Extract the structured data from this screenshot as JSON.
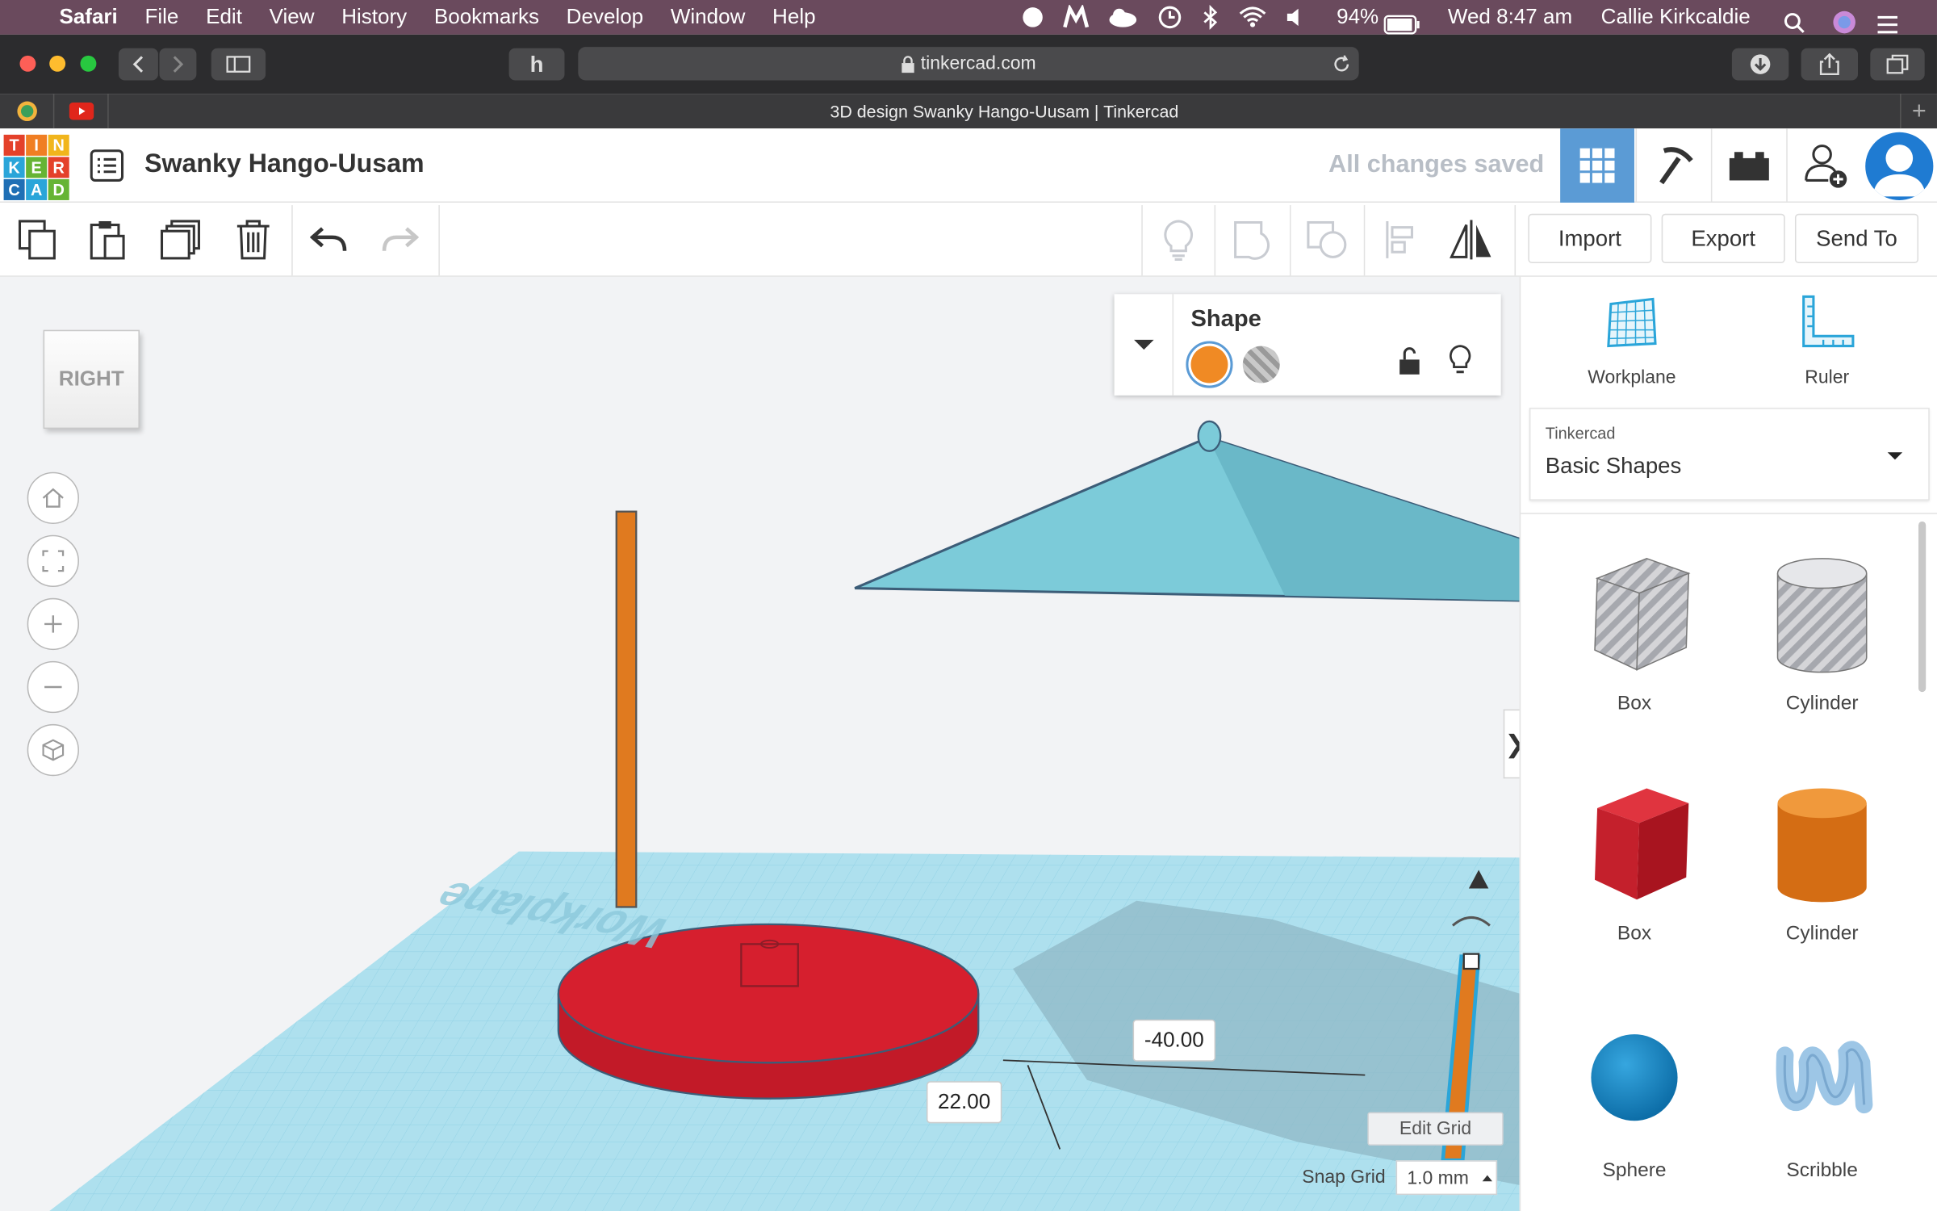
{
  "menubar": {
    "app": "Safari",
    "items": [
      "File",
      "Edit",
      "View",
      "History",
      "Bookmarks",
      "Develop",
      "Window",
      "Help"
    ],
    "battery": "94%",
    "clock": "Wed 8:47 am",
    "user": "Callie Kirkcaldie"
  },
  "browser": {
    "url": "tinkercad.com",
    "tab_title": "3D design Swanky Hango-Uusam | Tinkercad"
  },
  "header": {
    "logo": [
      "T",
      "I",
      "N",
      "K",
      "E",
      "R",
      "C",
      "A",
      "D"
    ],
    "design_name": "Swanky Hango-Uusam",
    "save_status": "All changes saved"
  },
  "toolbar": {
    "import": "Import",
    "export": "Export",
    "send_to": "Send To"
  },
  "viewcube": {
    "face": "RIGHT"
  },
  "inspector": {
    "title": "Shape"
  },
  "sidebar": {
    "workplane": "Workplane",
    "ruler": "Ruler",
    "library_group": "Tinkercad",
    "library": "Basic Shapes",
    "shapes": [
      {
        "label": "Box",
        "icon": "box-hole-icon"
      },
      {
        "label": "Cylinder",
        "icon": "cylinder-hole-icon"
      },
      {
        "label": "Box",
        "icon": "box-solid-icon"
      },
      {
        "label": "Cylinder",
        "icon": "cylinder-solid-icon"
      },
      {
        "label": "Sphere",
        "icon": "sphere-icon"
      },
      {
        "label": "Scribble",
        "icon": "scribble-icon"
      }
    ]
  },
  "workplane": {
    "watermark": "Workplane",
    "dim_x": "-40.00",
    "dim_y": "22.00",
    "edit_grid": "Edit Grid",
    "snap_label": "Snap Grid",
    "snap_value": "1.0 mm"
  },
  "colors": {
    "accent": "#5b9bd5",
    "red": "#d61f2e",
    "orange": "#e07a1f",
    "teal": "#7ccbd9",
    "grid": "#aee0ee"
  }
}
